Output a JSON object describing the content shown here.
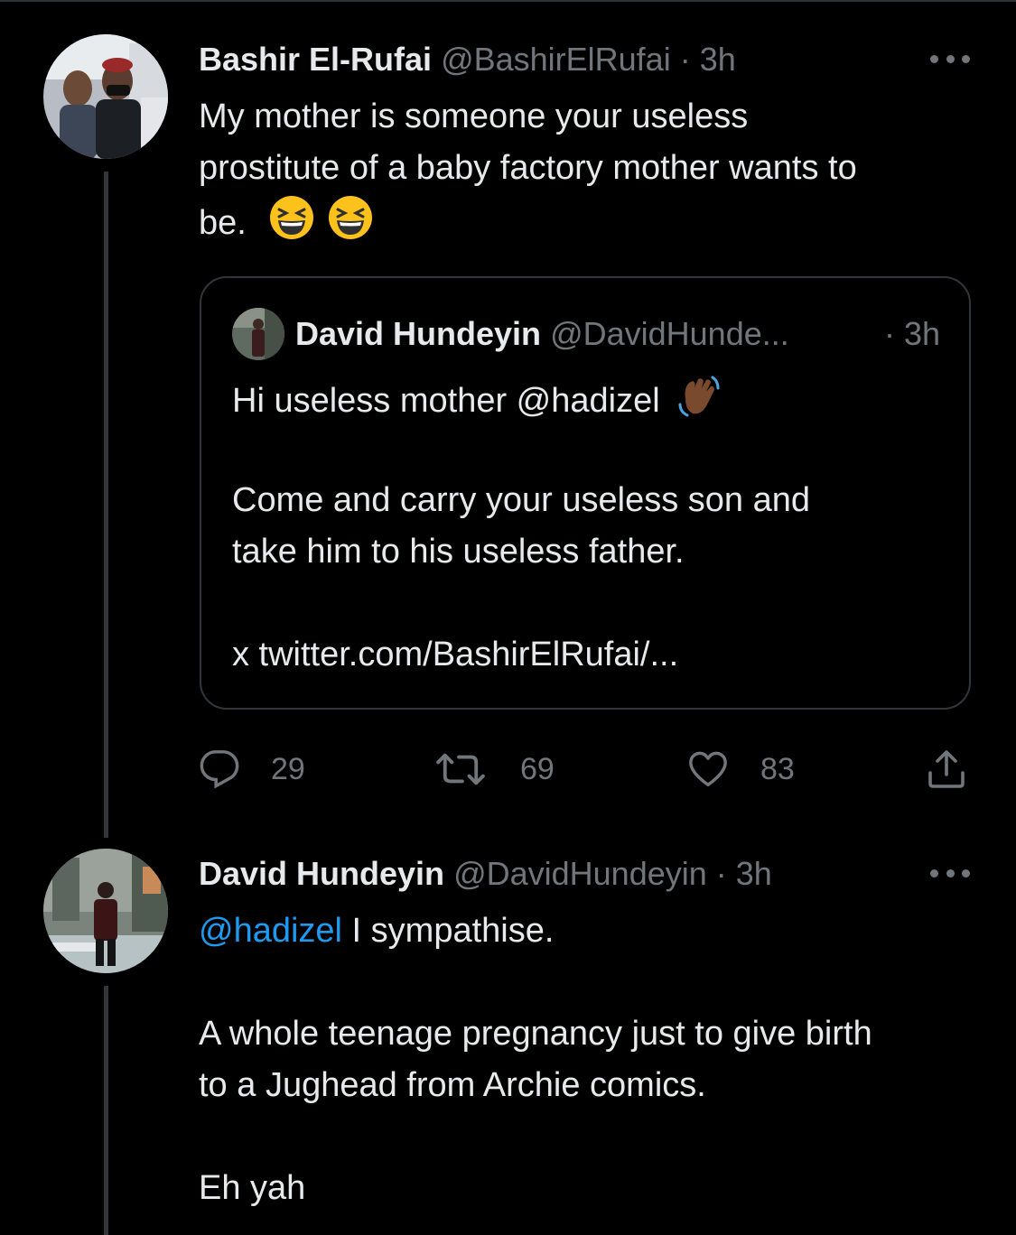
{
  "tweet1": {
    "name": "Bashir El-Rufai",
    "handle": "@BashirElRufai",
    "separator": "·",
    "time": "3h",
    "lines": [
      "My mother is someone your useless",
      "prostitute of a baby factory mother wants to",
      "be."
    ],
    "emojis": [
      "laughing-emoji",
      "laughing-emoji"
    ],
    "quote": {
      "name": "David Hundeyin",
      "handle": "@DavidHunde...",
      "time": "· 3h",
      "line1": "Hi useless mother @hadizel",
      "line1_emoji": "waving-hand-emoji",
      "line2": "Come and carry your useless son and",
      "line3": "take him to his useless father.",
      "line4": "x twitter.com/BashirElRufai/..."
    },
    "actions": {
      "replies": "29",
      "retweets": "69",
      "likes": "83"
    }
  },
  "tweet2": {
    "name": "David Hundeyin",
    "handle": "@DavidHundeyin",
    "separator": "·",
    "time": "3h",
    "mention": "@hadizel",
    "line1_rest": " I sympathise.",
    "line2": "A whole teenage pregnancy just to give birth",
    "line3": "to a Jughead from Archie comics.",
    "line4": "Eh yah"
  },
  "colors": {
    "background": "#000000",
    "text": "#e7e9ea",
    "secondary": "#71767b",
    "link": "#1d9bf0",
    "border": "#333639"
  }
}
